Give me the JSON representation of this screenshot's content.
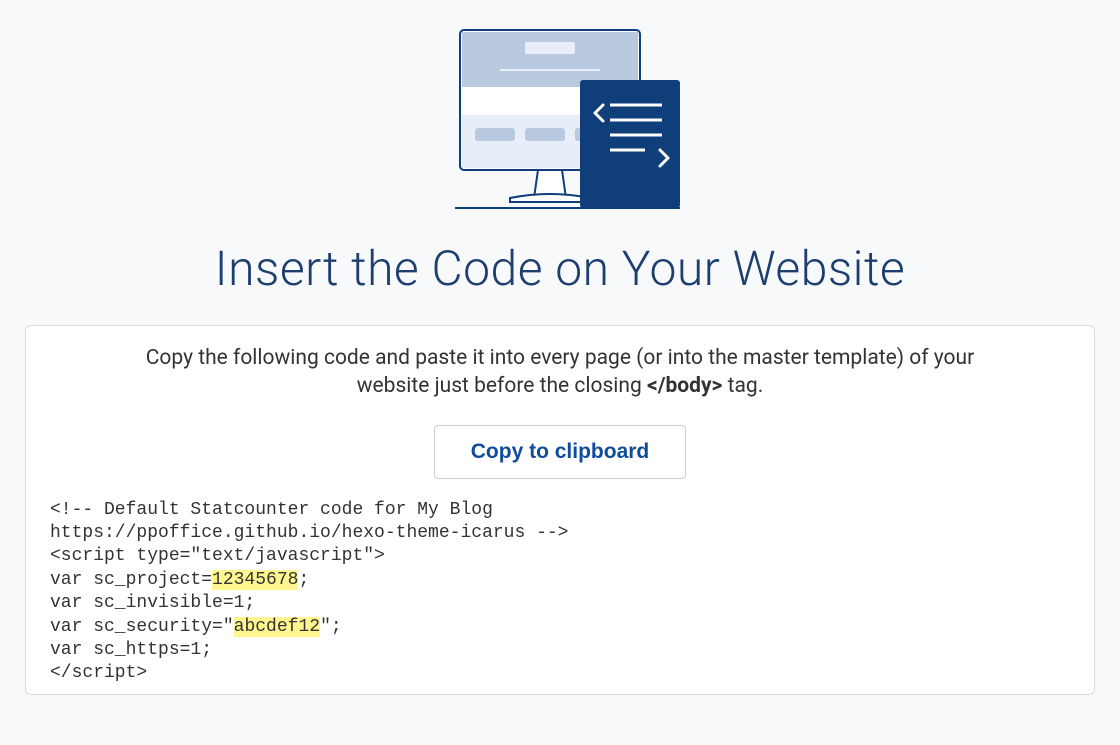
{
  "headline": "Insert the Code on Your Website",
  "instruction": {
    "before": "Copy the following code and paste it into every page (or into the master template) of your website just before the closing ",
    "tag": "</body>",
    "after": " tag."
  },
  "copy_button_label": "Copy to clipboard",
  "code": {
    "line1": "<!-- Default Statcounter code for My Blog",
    "line2": "https://ppoffice.github.io/hexo-theme-icarus -->",
    "line3": "<script type=\"text/javascript\">",
    "line4a": "var sc_project=",
    "line4hl": "12345678",
    "line4b": ";",
    "line5": "var sc_invisible=1;",
    "line6a": "var sc_security=\"",
    "line6hl": "abcdef12",
    "line6b": "\";",
    "line7": "var sc_https=1;",
    "line8": "</script>"
  }
}
